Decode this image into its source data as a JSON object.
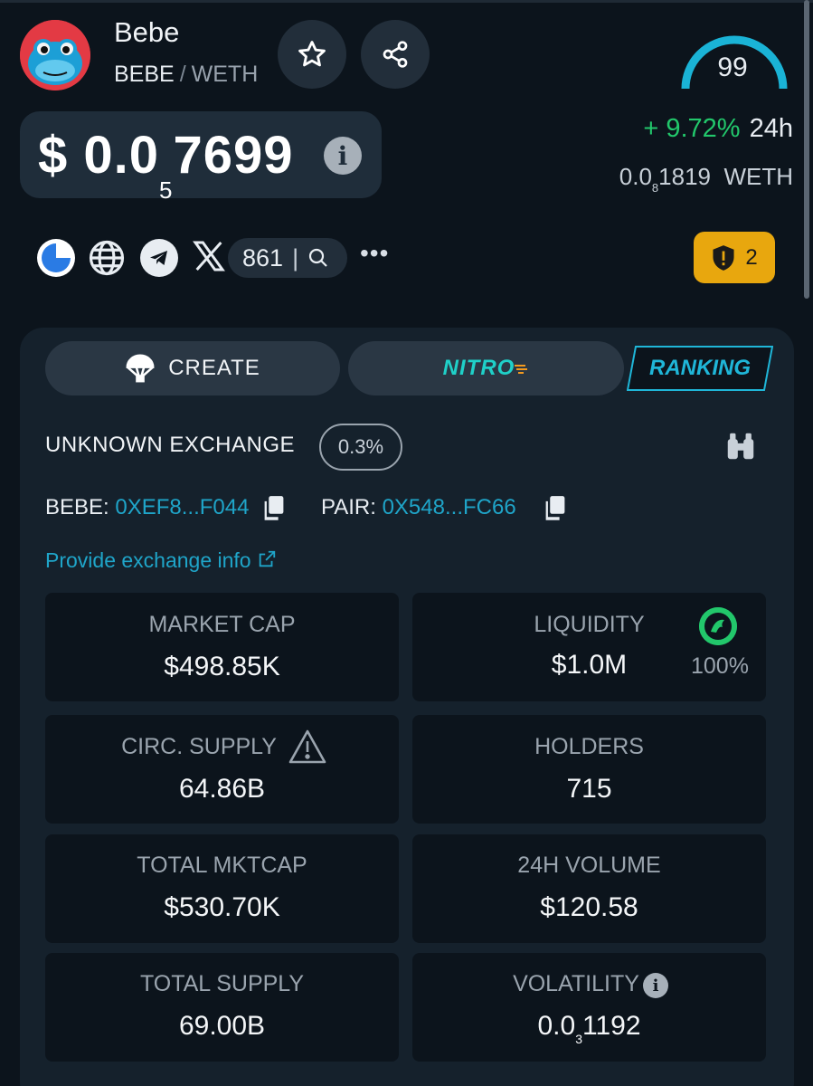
{
  "token": {
    "name": "Bebe",
    "symbol": "BEBE",
    "slash": "/",
    "quote": "WETH",
    "score": "99"
  },
  "price": {
    "usd_prefix": "$ 0.0",
    "usd_zeros": "5",
    "usd_digits": "7699",
    "change_24h": "+ 9.72%",
    "change_period": "24h",
    "weth_prefix": "0.0",
    "weth_zeros": "8",
    "weth_digits": "1819",
    "weth_unit": "WETH"
  },
  "socials": {
    "x_count": "861",
    "separator": "|",
    "more": "•••",
    "audit_count": "2"
  },
  "tabs": {
    "create": "CREATE",
    "nitro": "NITRO",
    "ranking": "RANKING"
  },
  "exchange": {
    "name": "UNKNOWN EXCHANGE",
    "fee": "0.3%",
    "token_label": "BEBE:",
    "token_address": "0XEF8...F044",
    "pair_label": "PAIR:",
    "pair_address": "0X548...FC66",
    "provide_info": "Provide exchange info"
  },
  "stats": {
    "market_cap": {
      "label": "MARKET CAP",
      "value": "$498.85K"
    },
    "liquidity": {
      "label": "LIQUIDITY",
      "value": "$1.0M",
      "locked_pct": "100%"
    },
    "circ_supply": {
      "label": "CIRC. SUPPLY",
      "value": "64.86B"
    },
    "holders": {
      "label": "HOLDERS",
      "value": "715"
    },
    "total_mktcap": {
      "label": "TOTAL MKTCAP",
      "value": "$530.70K"
    },
    "volume_24h": {
      "label": "24H VOLUME",
      "value": "$120.58"
    },
    "total_supply": {
      "label": "TOTAL SUPPLY",
      "value": "69.00B"
    },
    "volatility": {
      "label": "VOLATILITY",
      "value_prefix": "0.0",
      "value_zeros": "3",
      "value_digits": "1192"
    }
  },
  "colors": {
    "background": "#0c141c",
    "panel": "#15212c",
    "accent_cyan": "#1fa5c9",
    "positive_green": "#22c76b",
    "audit_amber": "#e8a70e"
  },
  "icons": [
    "star-icon",
    "share-icon",
    "info-icon",
    "website-icon",
    "globe-icon",
    "telegram-icon",
    "x-icon",
    "search-icon",
    "shield-alert-icon",
    "parachute-icon",
    "binoculars-icon",
    "copy-icon",
    "external-link-icon",
    "warning-icon",
    "uniswap-icon"
  ]
}
